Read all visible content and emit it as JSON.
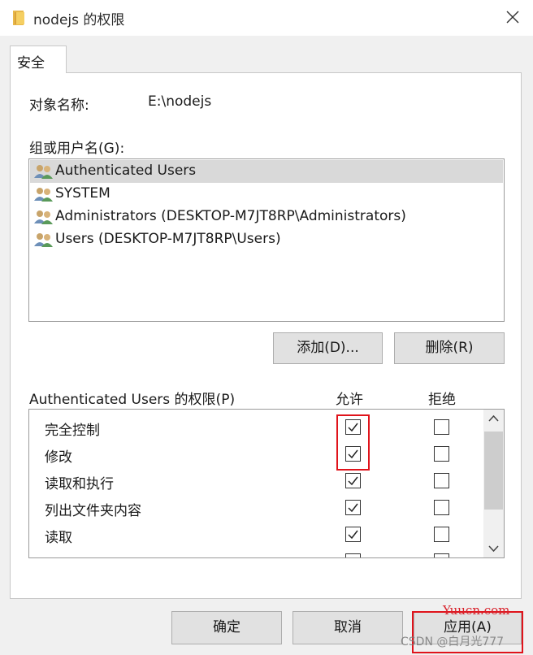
{
  "window": {
    "title": "nodejs 的权限",
    "icons": {
      "folder": "folder-icon",
      "close": "close-icon"
    }
  },
  "tabs": [
    {
      "label": "安全",
      "active": true
    }
  ],
  "object": {
    "label": "对象名称:",
    "value": "E:\\nodejs"
  },
  "groups": {
    "label": "组或用户名(G):",
    "items": [
      {
        "label": "Authenticated Users",
        "selected": true,
        "icon": "user-group-icon"
      },
      {
        "label": "SYSTEM",
        "selected": false,
        "icon": "user-group-icon"
      },
      {
        "label": "Administrators (DESKTOP-M7JT8RP\\Administrators)",
        "selected": false,
        "icon": "user-group-icon"
      },
      {
        "label": "Users (DESKTOP-M7JT8RP\\Users)",
        "selected": false,
        "icon": "user-group-icon"
      }
    ]
  },
  "group_buttons": {
    "add": "添加(D)...",
    "remove": "删除(R)"
  },
  "permissions": {
    "title": "Authenticated Users 的权限(P)",
    "allow_header": "允许",
    "deny_header": "拒绝",
    "rows": [
      {
        "name": "完全控制",
        "allow": true,
        "deny": false
      },
      {
        "name": "修改",
        "allow": true,
        "deny": false
      },
      {
        "name": "读取和执行",
        "allow": true,
        "deny": false
      },
      {
        "name": "列出文件夹内容",
        "allow": true,
        "deny": false
      },
      {
        "name": "读取",
        "allow": true,
        "deny": false
      }
    ]
  },
  "footer": {
    "ok": "确定",
    "cancel": "取消",
    "apply": "应用(A)"
  },
  "highlight_color": "#e0131b",
  "watermarks": {
    "site": "Yuucn.com",
    "author": "CSDN @白月光777"
  }
}
